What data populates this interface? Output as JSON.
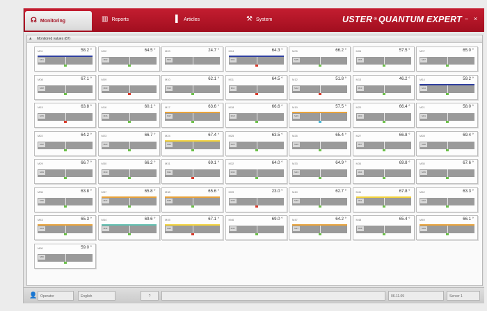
{
  "tabs": [
    {
      "label": "Monitoring",
      "icon": "monitoring-icon",
      "glyph": "☊"
    },
    {
      "label": "Reports",
      "icon": "reports-icon",
      "glyph": "▥"
    },
    {
      "label": "Articles",
      "icon": "articles-icon",
      "glyph": "▌"
    },
    {
      "label": "System",
      "icon": "system-icon",
      "glyph": "⚒"
    }
  ],
  "brand": {
    "name": "USTER",
    "reg": "®",
    "product": "QUANTUM EXPERT"
  },
  "window_buttons": {
    "minimize": "−",
    "close": "×"
  },
  "panel": {
    "title": "Monitored values (87)"
  },
  "colors": {
    "accent": "#b0162a",
    "band_blue": "#2f3f9f",
    "band_orange": "#e8a23a",
    "band_yellow": "#f2d23c",
    "band_teal": "#5fbfb0",
    "mark_green": "#6cc04a",
    "mark_red": "#d83a2a",
    "mark_cyan": "#46b6d8"
  },
  "tiles": [
    {
      "id": "M01",
      "value": "58.2 °",
      "band": "blue",
      "mark": "green"
    },
    {
      "id": "M02",
      "value": "64.5 °",
      "band": "none",
      "mark": "green"
    },
    {
      "id": "M03",
      "value": "24.7 °",
      "band": "none",
      "mark": "none"
    },
    {
      "id": "M04",
      "value": "64.3 °",
      "band": "blue",
      "mark": "red"
    },
    {
      "id": "M05",
      "value": "66.2 °",
      "band": "none",
      "mark": "green"
    },
    {
      "id": "M06",
      "value": "57.5 °",
      "band": "none",
      "mark": "green"
    },
    {
      "id": "M07",
      "value": "65.0 °",
      "band": "none",
      "mark": "green"
    },
    {
      "id": "M08",
      "value": "67.1 °",
      "band": "none",
      "mark": "green"
    },
    {
      "id": "M09",
      "value": "",
      "band": "none",
      "mark": "red"
    },
    {
      "id": "M10",
      "value": "62.1 °",
      "band": "none",
      "mark": "green"
    },
    {
      "id": "M11",
      "value": "64.5 °",
      "band": "none",
      "mark": "red"
    },
    {
      "id": "M12",
      "value": "51.8 °",
      "band": "none",
      "mark": "red"
    },
    {
      "id": "M13",
      "value": "46.2 °",
      "band": "none",
      "mark": "green"
    },
    {
      "id": "M14",
      "value": "59.2 °",
      "band": "blue",
      "mark": "green"
    },
    {
      "id": "M15",
      "value": "63.8 °",
      "band": "none",
      "mark": "red"
    },
    {
      "id": "M16",
      "value": "60.1 °",
      "band": "none",
      "mark": "green"
    },
    {
      "id": "M17",
      "value": "63.6 °",
      "band": "orange",
      "mark": "green"
    },
    {
      "id": "M18",
      "value": "66.6 °",
      "band": "none",
      "mark": "green"
    },
    {
      "id": "M19",
      "value": "57.5 °",
      "band": "orange",
      "mark": "cyan"
    },
    {
      "id": "M20",
      "value": "66.4 °",
      "band": "none",
      "mark": "green"
    },
    {
      "id": "M21",
      "value": "58.0 °",
      "band": "none",
      "mark": "green"
    },
    {
      "id": "M22",
      "value": "64.2 °",
      "band": "none",
      "mark": "green"
    },
    {
      "id": "M23",
      "value": "66.7 °",
      "band": "none",
      "mark": "green"
    },
    {
      "id": "M24",
      "value": "67.4 °",
      "band": "yellow",
      "mark": "green"
    },
    {
      "id": "M25",
      "value": "63.5 °",
      "band": "none",
      "mark": "green"
    },
    {
      "id": "M26",
      "value": "65.4 °",
      "band": "none",
      "mark": "green"
    },
    {
      "id": "M27",
      "value": "66.8 °",
      "band": "none",
      "mark": "green"
    },
    {
      "id": "M28",
      "value": "69.4 °",
      "band": "none",
      "mark": "green"
    },
    {
      "id": "M29",
      "value": "66.7 °",
      "band": "none",
      "mark": "green"
    },
    {
      "id": "M30",
      "value": "66.2 °",
      "band": "none",
      "mark": "green"
    },
    {
      "id": "M31",
      "value": "69.1 °",
      "band": "none",
      "mark": "red"
    },
    {
      "id": "M32",
      "value": "64.0 °",
      "band": "none",
      "mark": "green"
    },
    {
      "id": "M33",
      "value": "64.9 °",
      "band": "none",
      "mark": "green"
    },
    {
      "id": "M34",
      "value": "69.8 °",
      "band": "none",
      "mark": "green"
    },
    {
      "id": "M35",
      "value": "67.6 °",
      "band": "none",
      "mark": "green"
    },
    {
      "id": "M36",
      "value": "63.8 °",
      "band": "none",
      "mark": "green"
    },
    {
      "id": "M37",
      "value": "65.8 °",
      "band": "orange",
      "mark": "green"
    },
    {
      "id": "M38",
      "value": "65.6 °",
      "band": "orange",
      "mark": "green"
    },
    {
      "id": "M39",
      "value": "23.0 °",
      "band": "none",
      "mark": "red"
    },
    {
      "id": "M40",
      "value": "62.7 °",
      "band": "none",
      "mark": "green"
    },
    {
      "id": "M41",
      "value": "67.8 °",
      "band": "yellow",
      "mark": "green"
    },
    {
      "id": "M42",
      "value": "63.3 °",
      "band": "none",
      "mark": "green"
    },
    {
      "id": "M43",
      "value": "65.3 °",
      "band": "orange",
      "mark": "green"
    },
    {
      "id": "M44",
      "value": "69.6 °",
      "band": "teal",
      "mark": "green"
    },
    {
      "id": "M45",
      "value": "67.1 °",
      "band": "yellow",
      "mark": "red"
    },
    {
      "id": "M46",
      "value": "69.0 °",
      "band": "none",
      "mark": "green"
    },
    {
      "id": "M47",
      "value": "64.2 °",
      "band": "orange",
      "mark": "green"
    },
    {
      "id": "M48",
      "value": "65.4 °",
      "band": "none",
      "mark": "green"
    },
    {
      "id": "M49",
      "value": "66.1 °",
      "band": "orange",
      "mark": "green"
    },
    {
      "id": "M50",
      "value": "59.0 °",
      "band": "none",
      "mark": "green"
    }
  ],
  "status": {
    "user_icon": "user-icon",
    "user": "Operator",
    "lang": "English",
    "help": "?",
    "date": "06.11.09",
    "server": "Server 1"
  }
}
